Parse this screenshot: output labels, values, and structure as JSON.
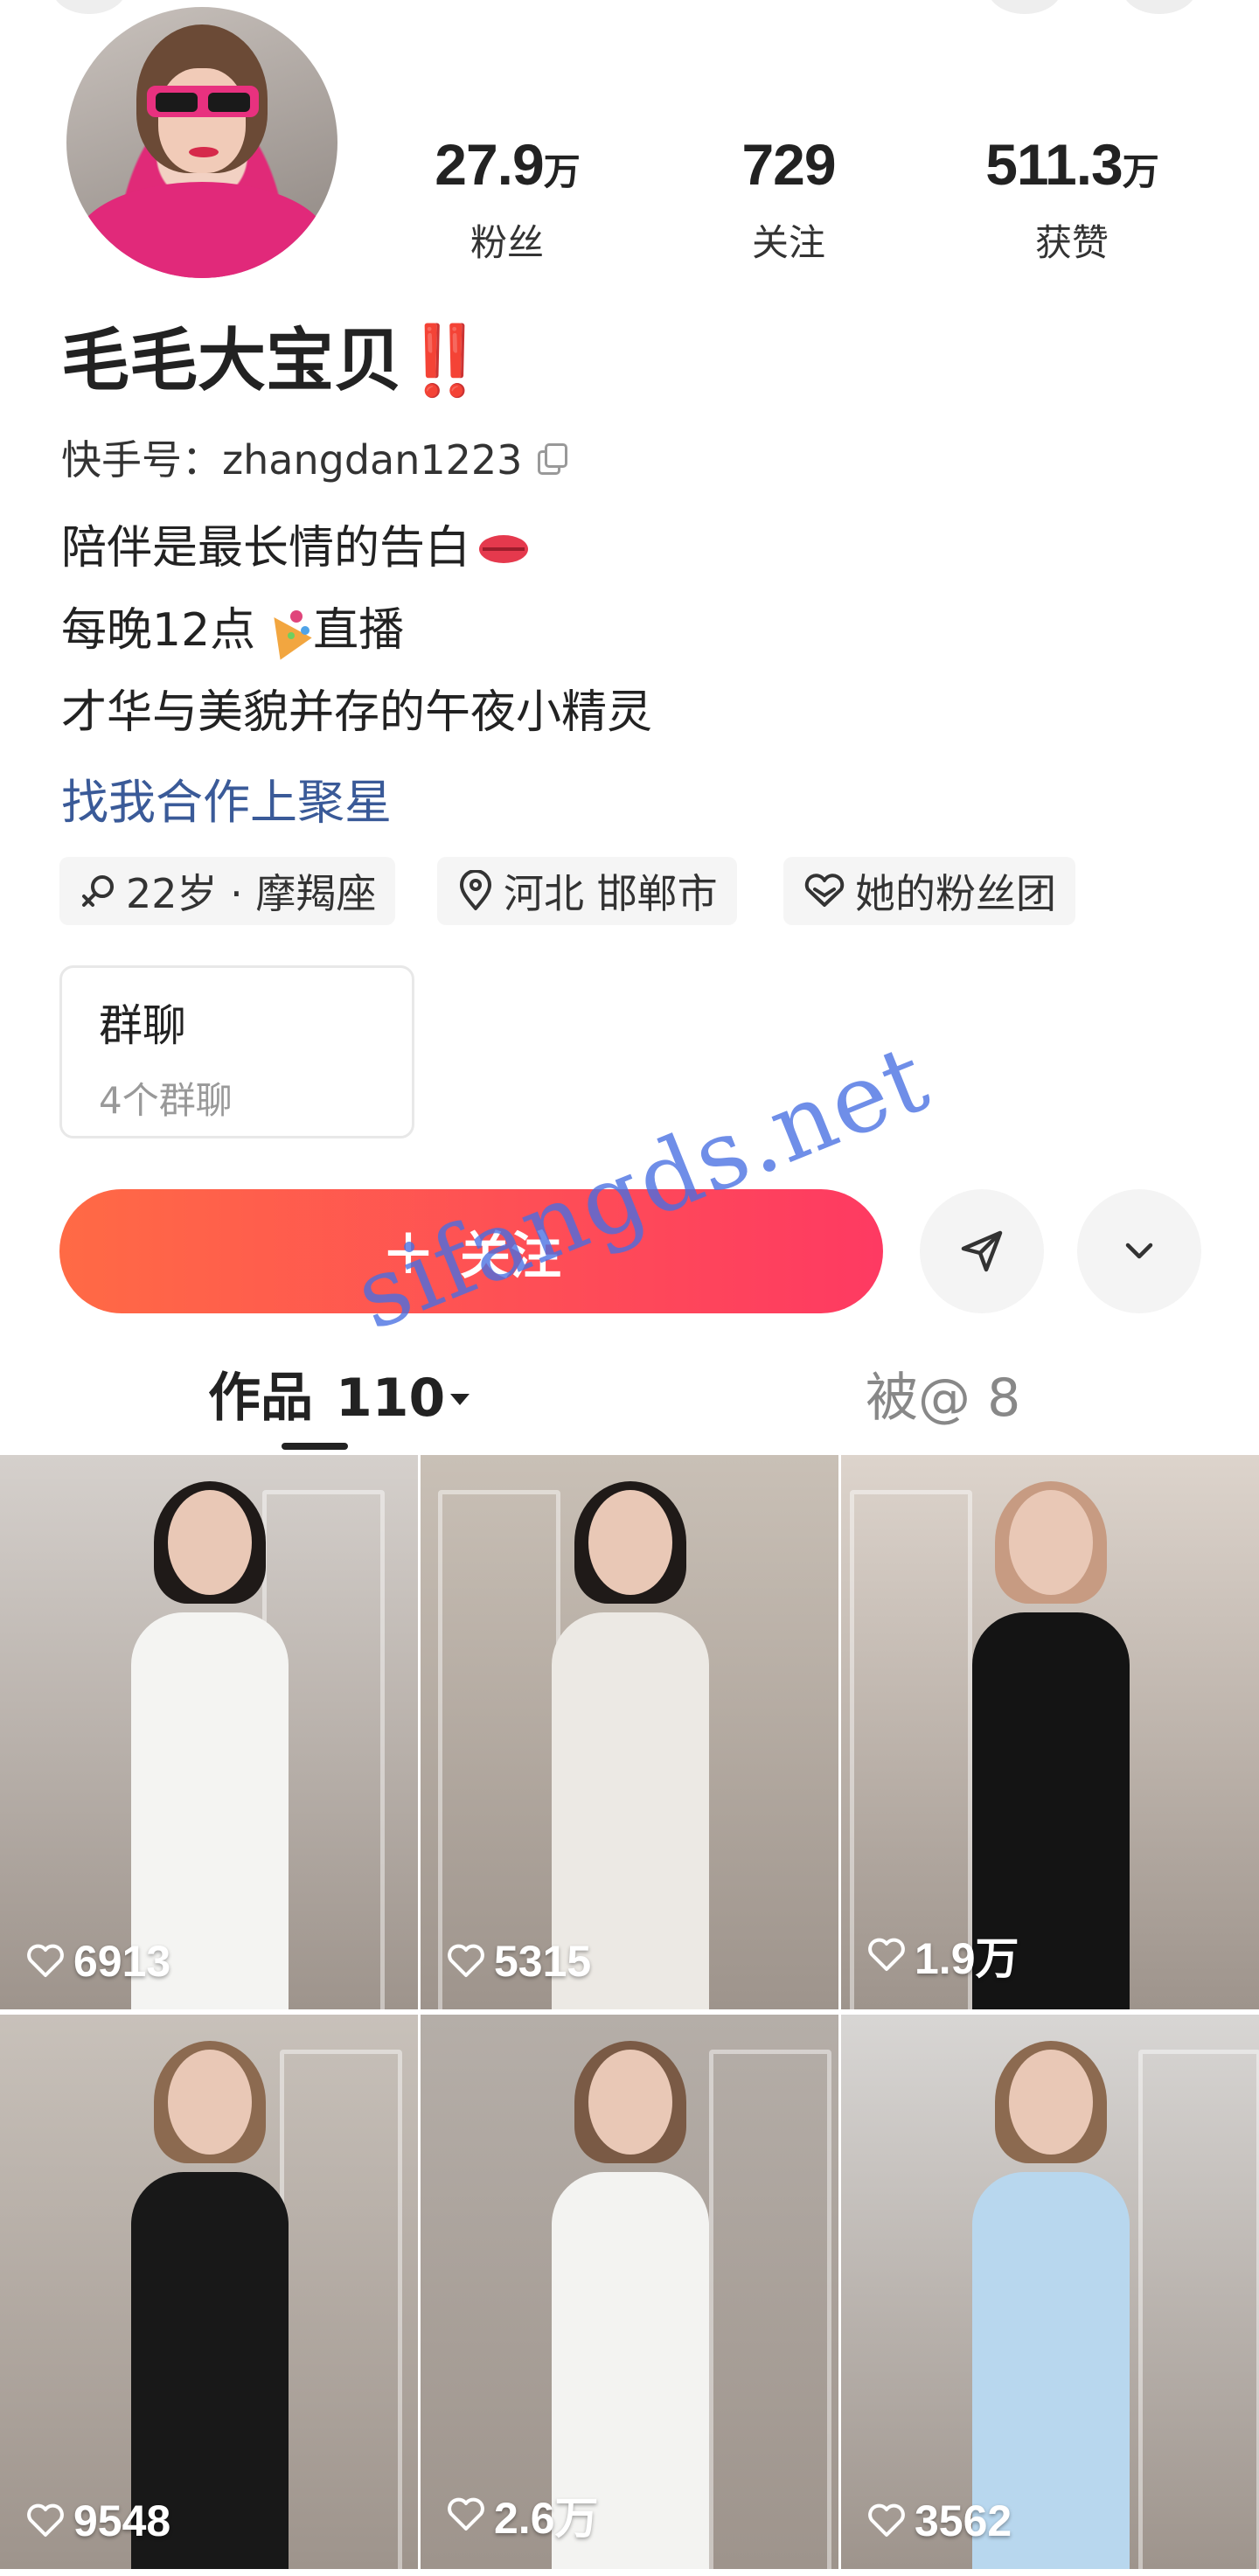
{
  "profile": {
    "name": "毛毛大宝贝",
    "name_emoji": "‼️",
    "kuaishou_id": "快手号：zhangdan1223",
    "bio_line1": "陪伴是最长情的告白",
    "bio_line2_a": "每晚12点",
    "bio_line2_b": "直播",
    "bio_line3": "才华与美貌并存的午夜小精灵",
    "collab_link": "找我合作上聚星"
  },
  "stats": [
    {
      "value": "27.9",
      "unit": "万",
      "label": "粉丝"
    },
    {
      "value": "729",
      "unit": "",
      "label": "关注"
    },
    {
      "value": "511.3",
      "unit": "万",
      "label": "获赞"
    }
  ],
  "tags": [
    {
      "icon": "female-icon",
      "text": "22岁 · 摩羯座"
    },
    {
      "icon": "location-pin-icon",
      "text": "河北 邯郸市"
    },
    {
      "icon": "fan-club-heart-icon",
      "text": "她的粉丝团"
    }
  ],
  "group_chat": {
    "title": "群聊",
    "subtitle": "4个群聊"
  },
  "actions": {
    "follow_label": "关注",
    "follow_plus": "+"
  },
  "tabs": {
    "works_label": "作品",
    "works_count": "110",
    "mentions_label": "被@ 8"
  },
  "watermark": "sifangds.net",
  "videos": [
    {
      "likes": "6913",
      "bg": "#d5d0cc",
      "outfit": "#f4f4f2",
      "hair": "#1f1a18"
    },
    {
      "likes": "5315",
      "bg": "#c9c0b6",
      "outfit": "#ece9e4",
      "hair": "#1f1a18"
    },
    {
      "likes": "1.9万",
      "bg": "#ddd4cc",
      "outfit": "#141414",
      "hair": "#c79b82"
    },
    {
      "likes": "9548",
      "bg": "#c8c1ba",
      "outfit": "#181818",
      "hair": "#8c6a50"
    },
    {
      "likes": "2.6万",
      "bg": "#b5aea8",
      "outfit": "#f3f3f1",
      "hair": "#7a5a45"
    },
    {
      "likes": "3562",
      "bg": "#d8d6d4",
      "outfit": "#b8d7ee",
      "hair": "#8c6a50"
    }
  ],
  "colors": {
    "follow_start": "#ff6a45",
    "follow_end": "#fe3a62",
    "collab_link": "#3a5a98",
    "watermark": "#466ee1"
  }
}
